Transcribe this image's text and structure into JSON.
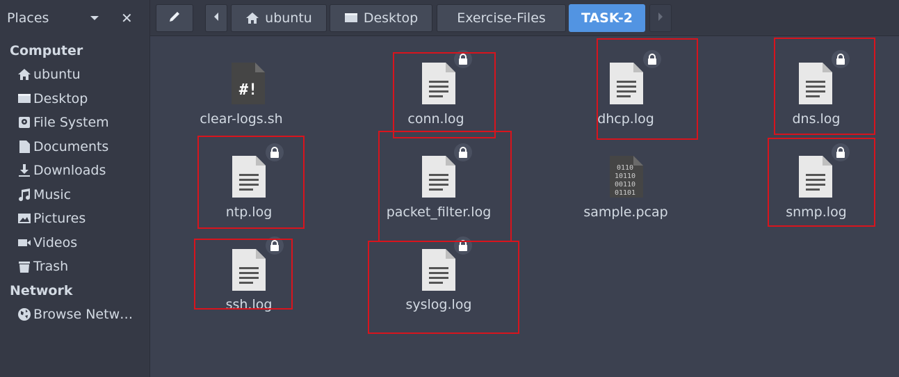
{
  "sidebar": {
    "header": "Places",
    "sections": {
      "computer": "Computer",
      "network": "Network"
    },
    "items": [
      {
        "label": "ubuntu",
        "icon": "home-icon"
      },
      {
        "label": "Desktop",
        "icon": "desktop-icon"
      },
      {
        "label": "File System",
        "icon": "drive-icon"
      },
      {
        "label": "Documents",
        "icon": "document-icon"
      },
      {
        "label": "Downloads",
        "icon": "download-icon"
      },
      {
        "label": "Music",
        "icon": "music-icon"
      },
      {
        "label": "Pictures",
        "icon": "pictures-icon"
      },
      {
        "label": "Videos",
        "icon": "video-icon"
      },
      {
        "label": "Trash",
        "icon": "trash-icon"
      }
    ],
    "network_items": [
      {
        "label": "Browse Netw…",
        "icon": "network-icon"
      }
    ]
  },
  "toolbar": {
    "breadcrumbs": [
      "ubuntu",
      "Desktop",
      "Exercise-Files",
      "TASK-2"
    ],
    "active_crumb": "TASK-2"
  },
  "files": [
    {
      "name": "clear-logs.sh",
      "type": "script",
      "locked": false
    },
    {
      "name": "conn.log",
      "type": "text",
      "locked": true
    },
    {
      "name": "dhcp.log",
      "type": "text",
      "locked": true
    },
    {
      "name": "dns.log",
      "type": "text",
      "locked": true
    },
    {
      "name": "ntp.log",
      "type": "text",
      "locked": true
    },
    {
      "name": "packet_filter.log",
      "type": "text",
      "locked": true
    },
    {
      "name": "sample.pcap",
      "type": "binary",
      "locked": false
    },
    {
      "name": "snmp.log",
      "type": "text",
      "locked": true
    },
    {
      "name": "ssh.log",
      "type": "text",
      "locked": true
    },
    {
      "name": "syslog.log",
      "type": "text",
      "locked": true
    }
  ],
  "colors": {
    "accent": "#5294e2",
    "highlight": "#d8141d",
    "background": "#3c4150"
  }
}
